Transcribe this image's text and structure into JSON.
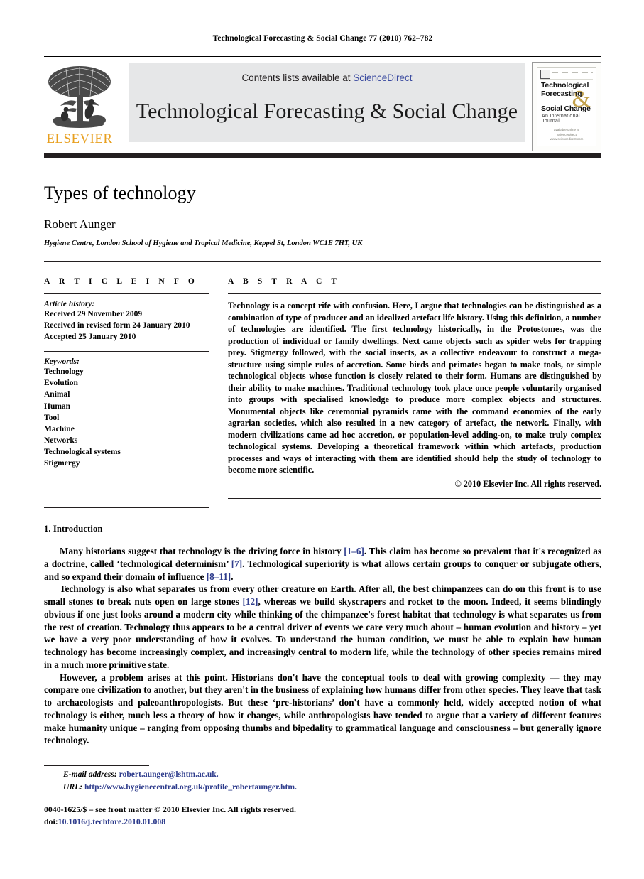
{
  "running_head": "Technological Forecasting & Social Change 77 (2010) 762–782",
  "masthead": {
    "publisher_logo_text": "ELSEVIER",
    "contents_prefix": "Contents lists available at ",
    "contents_link": "ScienceDirect",
    "journal_title": "Technological Forecasting & Social Change",
    "cover": {
      "line1": "Technological",
      "line2": "Forecasting",
      "line3": "Social Change",
      "subtitle": "An International Journal",
      "ampersand": "&",
      "footer_line1": "available online at",
      "footer_line2": "ScienceDirect",
      "footer_line3": "www.sciencedirect.com"
    }
  },
  "article": {
    "title": "Types of technology",
    "author": "Robert Aunger",
    "affiliation": "Hygiene Centre, London School of Hygiene and Tropical Medicine, Keppel St, London WC1E 7HT, UK"
  },
  "article_info": {
    "heading": "A R T I C L E   I N F O",
    "history_label": "Article history:",
    "history": [
      "Received 29 November 2009",
      "Received in revised form 24 January 2010",
      "Accepted 25 January 2010"
    ],
    "keywords_label": "Keywords:",
    "keywords": [
      "Technology",
      "Evolution",
      "Animal",
      "Human",
      "Tool",
      "Machine",
      "Networks",
      "Technological systems",
      "Stigmergy"
    ]
  },
  "abstract": {
    "heading": "A B S T R A C T",
    "text": "Technology is a concept rife with confusion. Here, I argue that technologies can be distinguished as a combination of type of producer and an idealized artefact life history. Using this definition, a number of technologies are identified. The first technology historically, in the Protostomes, was the production of individual or family dwellings. Next came objects such as spider webs for trapping prey. Stigmergy followed, with the social insects, as a collective endeavour to construct a mega-structure using simple rules of accretion. Some birds and primates began to make tools, or simple technological objects whose function is closely related to their form. Humans are distinguished by their ability to make machines. Traditional technology took place once people voluntarily organised into groups with specialised knowledge to produce more complex objects and structures. Monumental objects like ceremonial pyramids came with the command economies of the early agrarian societies, which also resulted in a new category of artefact, the network. Finally, with modern civilizations came ad hoc accretion, or population-level adding-on, to make truly complex technological systems. Developing a theoretical framework within which artefacts, production processes and ways of interacting with them are identified should help the study of technology to become more scientific.",
    "copyright": "© 2010 Elsevier Inc. All rights reserved."
  },
  "section": {
    "heading": "1. Introduction",
    "paragraphs": [
      {
        "parts": [
          {
            "t": "Many historians suggest that technology is the driving force in history "
          },
          {
            "t": "[1–6]",
            "ref": true
          },
          {
            "t": ". This claim has become so prevalent that it's recognized as a doctrine, called ‘technological determinism’ "
          },
          {
            "t": "[7]",
            "ref": true
          },
          {
            "t": ". Technological superiority is what allows certain groups to conquer or subjugate others, and so expand their domain of influence "
          },
          {
            "t": "[8–11]",
            "ref": true
          },
          {
            "t": "."
          }
        ]
      },
      {
        "parts": [
          {
            "t": "Technology is also what separates us from every other creature on Earth. After all, the best chimpanzees can do on this front is to use small stones to break nuts open on large stones "
          },
          {
            "t": "[12]",
            "ref": true
          },
          {
            "t": ", whereas we build skyscrapers and rocket to the moon. Indeed, it seems blindingly obvious if one just looks around a modern city while thinking of the chimpanzee's forest habitat that technology is what separates us from the rest of creation. Technology thus appears to be a central driver of events we care very much about – human evolution and history – yet we have a very poor understanding of how it evolves. To understand the human condition, we must be able to explain how human technology has become increasingly complex, and increasingly central to modern life, while the technology of other species remains mired in a much more primitive state."
          }
        ]
      },
      {
        "parts": [
          {
            "t": "However, a problem arises at this point. Historians don't have the conceptual tools to deal with growing complexity — they may compare one civilization to another, but they aren't in the business of explaining how humans differ from other species. They leave that task to archaeologists and paleoanthropologists. But these ‘pre-historians’ don't have a commonly held, widely accepted notion of what technology is either, much less a theory of how it changes, while anthropologists have tended to argue that a variety of different features make humanity unique – ranging from opposing thumbs and bipedality to grammatical language and consciousness – but generally ignore technology."
          }
        ]
      }
    ]
  },
  "footer": {
    "email_label": "E-mail address:",
    "email_value": "robert.aunger@lshtm.ac.uk.",
    "url_label": "URL:",
    "url_value": "http://www.hygienecentral.org.uk/profile_robertaunger.htm.",
    "issn_line": "0040-1625/$ – see front matter © 2010 Elsevier Inc. All rights reserved.",
    "doi_label": "doi:",
    "doi_value": "10.1016/j.techfore.2010.01.008"
  },
  "colors": {
    "link": "#2e3c8c",
    "sciencedirect": "#3b4ba0",
    "elsevier_orange": "#E8A020",
    "banner_grey": "#e6e7e8",
    "rule": "#231f20"
  }
}
